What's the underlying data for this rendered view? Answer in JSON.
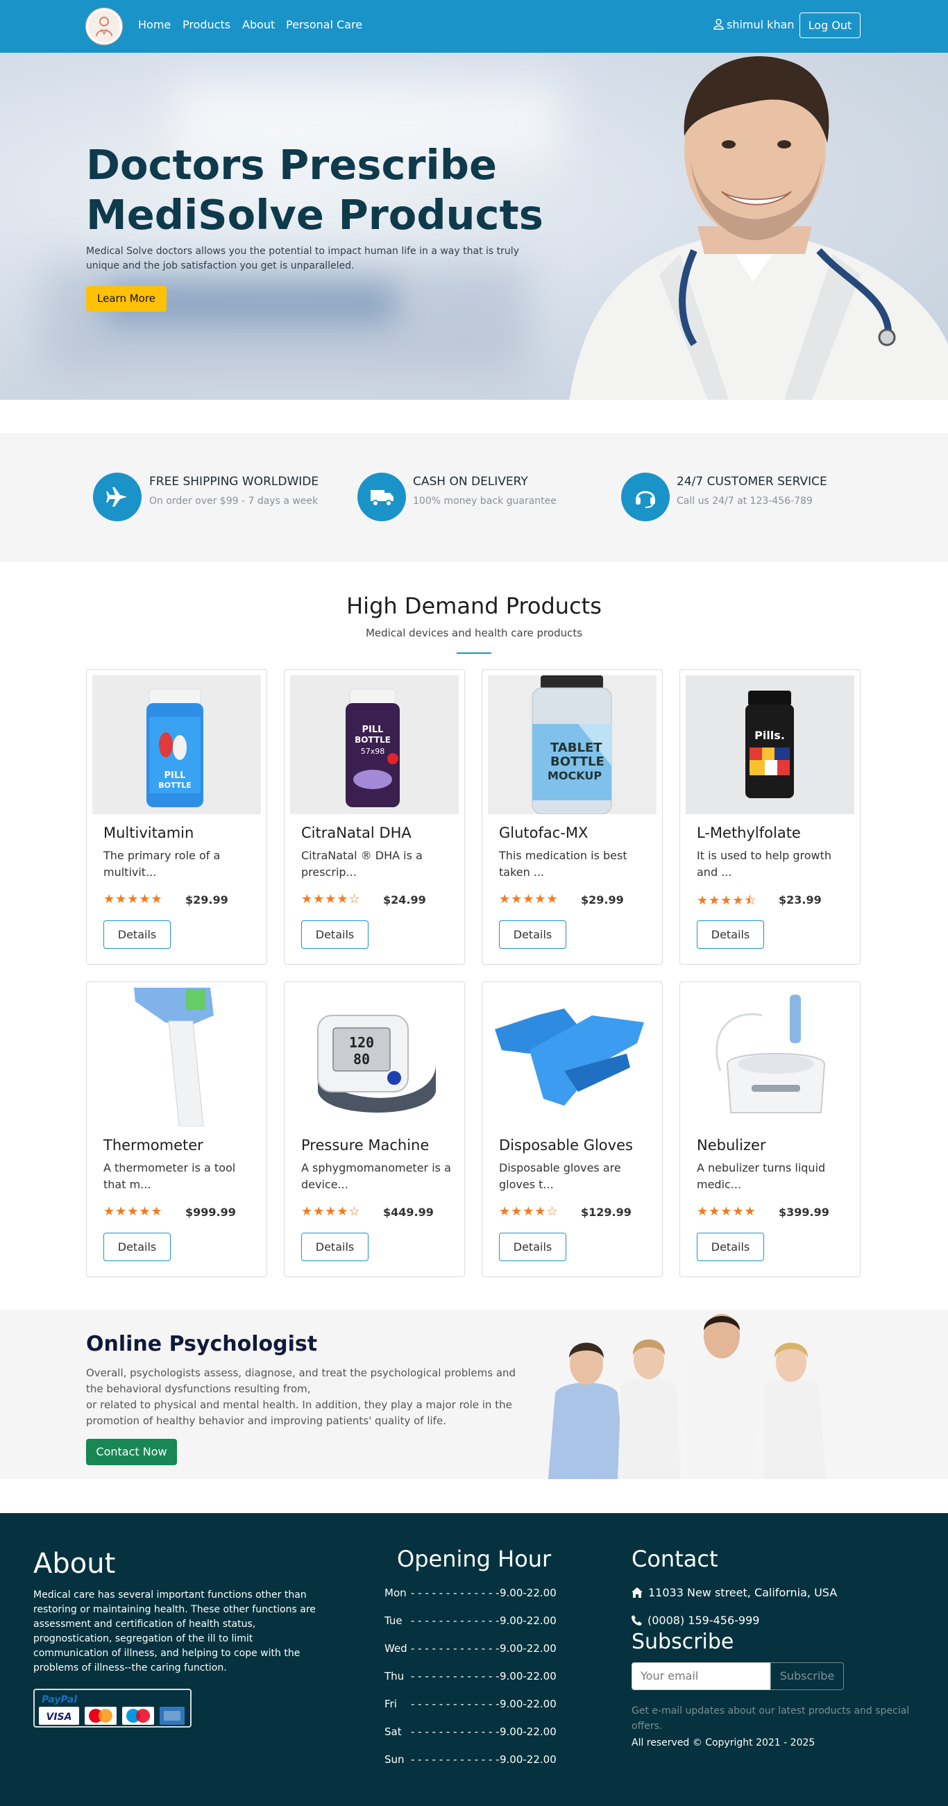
{
  "nav": {
    "links": [
      "Home",
      "Products",
      "About",
      "Personal Care"
    ],
    "user": "shimul khan",
    "logout": "Log Out"
  },
  "hero": {
    "title": "Doctors Prescribe MediSolve Products",
    "text": "Medical Solve doctors allows you the potential to impact human life in a way that is truly unique and the job satisfaction you get is unparalleled.",
    "button": "Learn More"
  },
  "features": [
    {
      "icon": "airplane-icon",
      "title": "FREE SHIPPING WORLDWIDE",
      "subtitle": "On order over $99 - 7 days a week"
    },
    {
      "icon": "truck-icon",
      "title": "CASH ON DELIVERY",
      "subtitle": "100% money back guarantee"
    },
    {
      "icon": "headset-icon",
      "title": "24/7 CUSTOMER SERVICE",
      "subtitle": "Call us 24/7 at 123-456-789"
    }
  ],
  "products_section": {
    "title": "High Demand Products",
    "subtitle": "Medical devices and health care products",
    "details_label": "Details",
    "items": [
      {
        "name": "Multivitamin",
        "desc": "The primary role of a multivit...",
        "rating": 5,
        "price": "$29.99",
        "image": "pill-bottle-blue"
      },
      {
        "name": "CitraNatal DHA",
        "desc": "CitraNatal ® DHA is a prescrip...",
        "rating": 4,
        "price": "$24.99",
        "image": "pill-bottle-purple"
      },
      {
        "name": "Glutofac-MX",
        "desc": "This medication is best taken ...",
        "rating": 5,
        "price": "$29.99",
        "image": "tablet-bottle"
      },
      {
        "name": "L-Methylfolate",
        "desc": "It is used to help growth and ...",
        "rating": 4.5,
        "price": "$23.99",
        "image": "pills-jar"
      },
      {
        "name": "Thermometer",
        "desc": "A thermometer is a tool that m...",
        "rating": 5,
        "price": "$999.99",
        "image": "thermometer"
      },
      {
        "name": "Pressure Machine",
        "desc": "A sphygmomanometer is a device...",
        "rating": 4,
        "price": "$449.99",
        "image": "pressure-monitor"
      },
      {
        "name": "Disposable Gloves",
        "desc": "Disposable gloves are gloves t...",
        "rating": 4,
        "price": "$129.99",
        "image": "blue-gloves"
      },
      {
        "name": "Nebulizer",
        "desc": "A nebulizer turns liquid medic...",
        "rating": 5,
        "price": "$399.99",
        "image": "nebulizer"
      }
    ]
  },
  "psychologist": {
    "title": "Online Psychologist",
    "text1": "Overall, psychologists assess, diagnose, and treat the psychological problems and the behavioral dysfunctions resulting from,",
    "text2": "or related to physical and mental health. In addition, they play a major role in the promotion of healthy behavior and improving patients' quality of life.",
    "button": "Contact Now"
  },
  "footer": {
    "about_title": "About",
    "about_text": "Medical care has several important functions other than restoring or maintaining health. These other functions are assessment and certification of health status, prognostication, segregation of the ill to limit communication of illness, and helping to cope with the problems of illness--the caring function.",
    "payment_logos": [
      "PayPal",
      "VISA",
      "MasterCard",
      "Maestro",
      "American Express"
    ],
    "hours_title": "Opening Hour",
    "hours": [
      {
        "day": "Mon",
        "time": "9.00-22.00"
      },
      {
        "day": "Tue",
        "time": "9.00-22.00"
      },
      {
        "day": "Wed",
        "time": "9.00-22.00"
      },
      {
        "day": "Thu",
        "time": "9.00-22.00"
      },
      {
        "day": "Fri",
        "time": "9.00-22.00"
      },
      {
        "day": "Sat",
        "time": "9.00-22.00"
      },
      {
        "day": "Sun",
        "time": "9.00-22.00"
      }
    ],
    "contact_title": "Contact",
    "address": "11033 New street, California, USA",
    "phone": "(0008) 159-456-999",
    "subscribe_title": "Subscribe",
    "email_placeholder": "Your email",
    "subscribe_button": "Subscribe",
    "note": "Get e-mail updates about our latest products and special offers.",
    "copyright": "All reserved © Copyright 2021 - 2025"
  }
}
